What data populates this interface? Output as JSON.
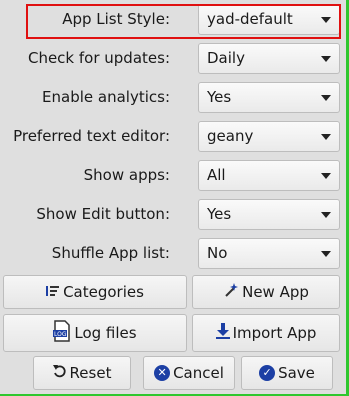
{
  "settings": [
    {
      "label": "App List Style:",
      "value": "yad-default"
    },
    {
      "label": "Check for updates:",
      "value": "Daily"
    },
    {
      "label": "Enable analytics:",
      "value": "Yes"
    },
    {
      "label": "Preferred text editor:",
      "value": "geany"
    },
    {
      "label": "Show apps:",
      "value": "All"
    },
    {
      "label": "Show Edit button:",
      "value": "Yes"
    },
    {
      "label": "Shuffle App list:",
      "value": "No"
    }
  ],
  "buttons": {
    "categories": "Categories",
    "new_app": "New App",
    "log_files": "Log files",
    "import_app": "Import App",
    "reset": "Reset",
    "cancel": "Cancel",
    "save": "Save"
  },
  "icons": {
    "categories": "sort-list-icon",
    "new_app": "magic-wand-icon",
    "log_files": "log-file-icon",
    "import_app": "download-arrow-icon",
    "reset": "reset-arrow-icon",
    "cancel": "cancel-circle-icon",
    "save": "check-circle-icon"
  },
  "colors": {
    "highlight": "#e01010",
    "icon_blue": "#1c3fa4",
    "window_edge": "#2fc72f"
  }
}
